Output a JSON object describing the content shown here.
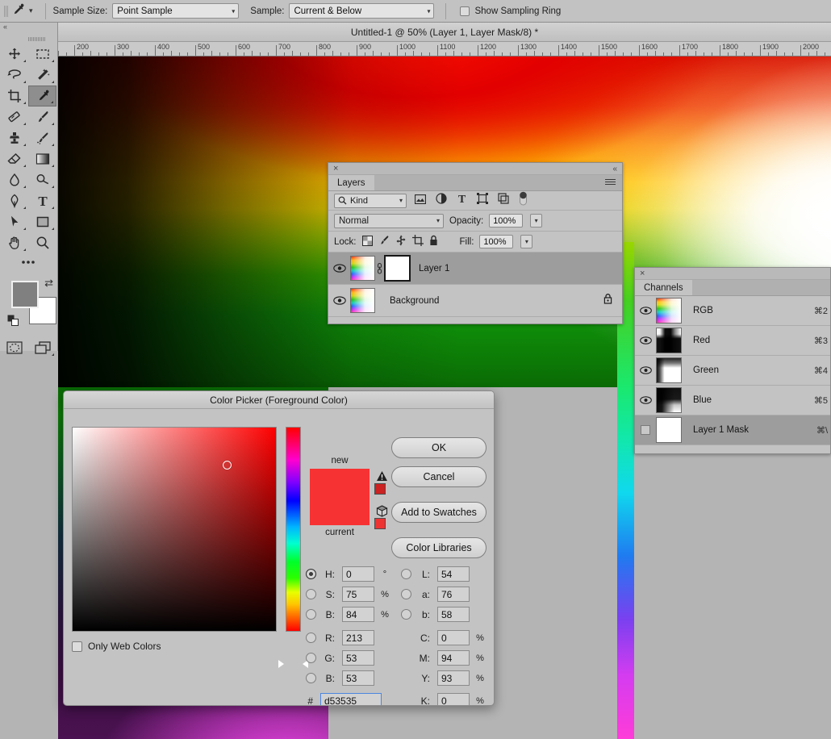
{
  "options_bar": {
    "tool_icon": "eyedropper-icon",
    "sample_size_label": "Sample Size:",
    "sample_size_value": "Point Sample",
    "sample_label": "Sample:",
    "sample_value": "Current & Below",
    "show_sampling_ring_label": "Show Sampling Ring",
    "show_sampling_ring_checked": false
  },
  "toolbar": {
    "collapse_label": "«",
    "tools": [
      {
        "name": "move-tool",
        "selected": false
      },
      {
        "name": "rectangular-marquee-tool",
        "selected": false
      },
      {
        "name": "lasso-tool",
        "selected": false
      },
      {
        "name": "magic-wand-tool",
        "selected": false
      },
      {
        "name": "crop-tool",
        "selected": false
      },
      {
        "name": "eyedropper-tool",
        "selected": true
      },
      {
        "name": "healing-brush-tool",
        "selected": false
      },
      {
        "name": "brush-tool",
        "selected": false
      },
      {
        "name": "clone-stamp-tool",
        "selected": false
      },
      {
        "name": "history-brush-tool",
        "selected": false
      },
      {
        "name": "eraser-tool",
        "selected": false
      },
      {
        "name": "gradient-tool",
        "selected": false
      },
      {
        "name": "blur-tool",
        "selected": false
      },
      {
        "name": "dodge-tool",
        "selected": false
      },
      {
        "name": "pen-tool",
        "selected": false
      },
      {
        "name": "type-tool",
        "selected": false
      },
      {
        "name": "path-selection-tool",
        "selected": false
      },
      {
        "name": "rectangle-tool",
        "selected": false
      },
      {
        "name": "hand-tool",
        "selected": false
      },
      {
        "name": "zoom-tool",
        "selected": false
      },
      {
        "name": "edit-toolbar-tool",
        "selected": false
      }
    ],
    "foreground_color": "#808080",
    "background_color": "#ffffff",
    "quick_mask_name": "quick-mask-icon",
    "screen_mode_name": "screen-mode-icon"
  },
  "document": {
    "title": "Untitled-1 @ 50% (Layer 1, Layer Mask/8) *",
    "zoom": "50%",
    "ruler_marks": [
      "200",
      "300",
      "400",
      "500",
      "600",
      "700",
      "800",
      "900",
      "1000",
      "1100",
      "1200",
      "1300",
      "1400",
      "1500",
      "1600",
      "1700",
      "1800",
      "1900",
      "2000"
    ]
  },
  "layers_panel": {
    "tab_label": "Layers",
    "close_label": "×",
    "collapse_label": "«",
    "filter_kind_label": "Kind",
    "filter_icons": [
      "pixel-filter-icon",
      "adjustment-filter-icon",
      "type-filter-icon",
      "shape-filter-icon",
      "smartobject-filter-icon",
      "filter-toggle-switch"
    ],
    "blend_mode": "Normal",
    "opacity_label": "Opacity:",
    "opacity_value": "100%",
    "lock_label": "Lock:",
    "lock_icons": [
      "lock-transparent-pixels-icon",
      "lock-image-pixels-icon",
      "lock-position-icon",
      "lock-artboard-icon",
      "lock-all-icon"
    ],
    "fill_label": "Fill:",
    "fill_value": "100%",
    "layers": [
      {
        "name": "Layer 1",
        "visible": true,
        "active": true,
        "has_mask": true,
        "linked": true,
        "locked": false
      },
      {
        "name": "Background",
        "visible": true,
        "active": false,
        "has_mask": false,
        "linked": false,
        "locked": true
      }
    ]
  },
  "channels_panel": {
    "tab_label": "Channels",
    "close_label": "×",
    "channels": [
      {
        "name": "RGB",
        "shortcut": "⌘2",
        "visible": true,
        "active": false,
        "thumb": "th-rgb"
      },
      {
        "name": "Red",
        "shortcut": "⌘3",
        "visible": true,
        "active": false,
        "thumb": "th-r"
      },
      {
        "name": "Green",
        "shortcut": "⌘4",
        "visible": true,
        "active": false,
        "thumb": "th-g"
      },
      {
        "name": "Blue",
        "shortcut": "⌘5",
        "visible": true,
        "active": false,
        "thumb": "th-b"
      },
      {
        "name": "Layer 1 Mask",
        "shortcut": "⌘\\",
        "visible": false,
        "active": true,
        "thumb": "th-white"
      }
    ]
  },
  "color_picker": {
    "title": "Color Picker (Foreground Color)",
    "new_label": "new",
    "current_label": "current",
    "new_color": "#f73232",
    "current_color": "#e03030",
    "out_of_gamut_chip": "#cc2222",
    "not_web_safe_chip": "#ee3333",
    "only_web_colors_label": "Only Web Colors",
    "only_web_colors_checked": false,
    "buttons": [
      {
        "label": "OK",
        "name": "ok-button"
      },
      {
        "label": "Cancel",
        "name": "cancel-button"
      },
      {
        "label": "Add to Swatches",
        "name": "add-to-swatches-button"
      },
      {
        "label": "Color Libraries",
        "name": "color-libraries-button"
      }
    ],
    "hsb": [
      {
        "key": "H:",
        "value": "0",
        "unit": "°",
        "selected": true
      },
      {
        "key": "S:",
        "value": "75",
        "unit": "%",
        "selected": false
      },
      {
        "key": "B:",
        "value": "84",
        "unit": "%",
        "selected": false
      }
    ],
    "rgb": [
      {
        "key": "R:",
        "value": "213",
        "unit": "",
        "selected": false
      },
      {
        "key": "G:",
        "value": "53",
        "unit": "",
        "selected": false
      },
      {
        "key": "B:",
        "value": "53",
        "unit": "",
        "selected": false
      }
    ],
    "lab": [
      {
        "key": "L:",
        "value": "54",
        "unit": "",
        "selected": false
      },
      {
        "key": "a:",
        "value": "76",
        "unit": "",
        "selected": false
      },
      {
        "key": "b:",
        "value": "58",
        "unit": "",
        "selected": false
      }
    ],
    "cmyk": [
      {
        "key": "C:",
        "value": "0",
        "unit": "%"
      },
      {
        "key": "M:",
        "value": "94",
        "unit": "%"
      },
      {
        "key": "Y:",
        "value": "93",
        "unit": "%"
      },
      {
        "key": "K:",
        "value": "0",
        "unit": "%"
      }
    ],
    "hex_label": "#",
    "hex_value": "d53535"
  }
}
